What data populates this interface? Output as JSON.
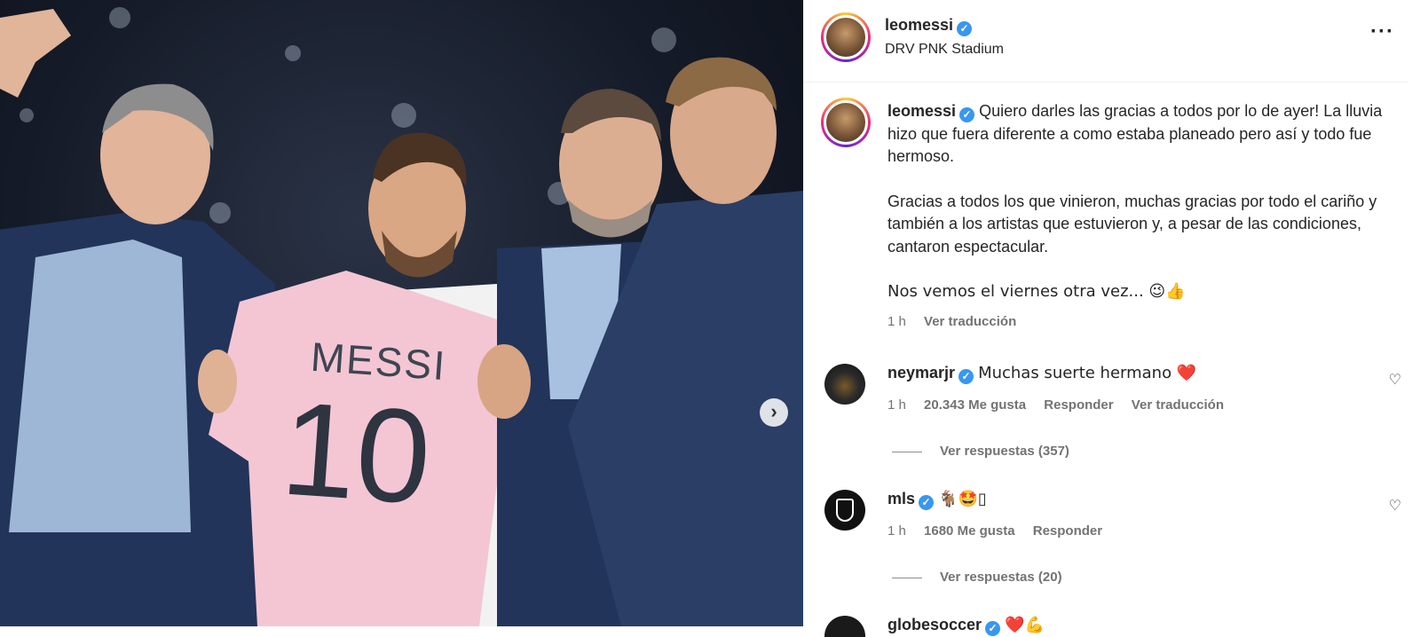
{
  "post": {
    "author": "leomessi",
    "location": "DRV PNK Stadium",
    "more_icon": "more-horizontal-icon",
    "jersey_name": "MESSI",
    "jersey_number": "10"
  },
  "caption": {
    "username": "leomessi",
    "paragraph_1": "Quiero darles las gracias a todos por lo de ayer! La lluvia hizo que fuera diferente a como estaba planeado pero así y todo fue hermoso.",
    "paragraph_2": "Gracias a todos los que vinieron, muchas gracias por todo el cariño y también a los artistas que estuvieron y, a pesar de las condiciones, cantaron espectacular.",
    "paragraph_3": "Nos vemos el viernes otra vez... 😉👍",
    "time": "1 h",
    "translate": "Ver traducción"
  },
  "comments": [
    {
      "username": "neymarjr",
      "text": "Muchas suerte hermano ❤️",
      "time": "1 h",
      "likes": "20.343 Me gusta",
      "reply": "Responder",
      "translate": "Ver traducción",
      "replies": "Ver respuestas (357)"
    },
    {
      "username": "mls",
      "text": "🐐🤩▯",
      "time": "1 h",
      "likes": "1680 Me gusta",
      "reply": "Responder",
      "replies": "Ver respuestas (20)"
    },
    {
      "username": "globesoccer",
      "text": "❤️💪"
    }
  ],
  "colors": {
    "verified": "#3897f0",
    "jersey_pink": "#f4c6d4",
    "suit_navy": "#22345a"
  }
}
